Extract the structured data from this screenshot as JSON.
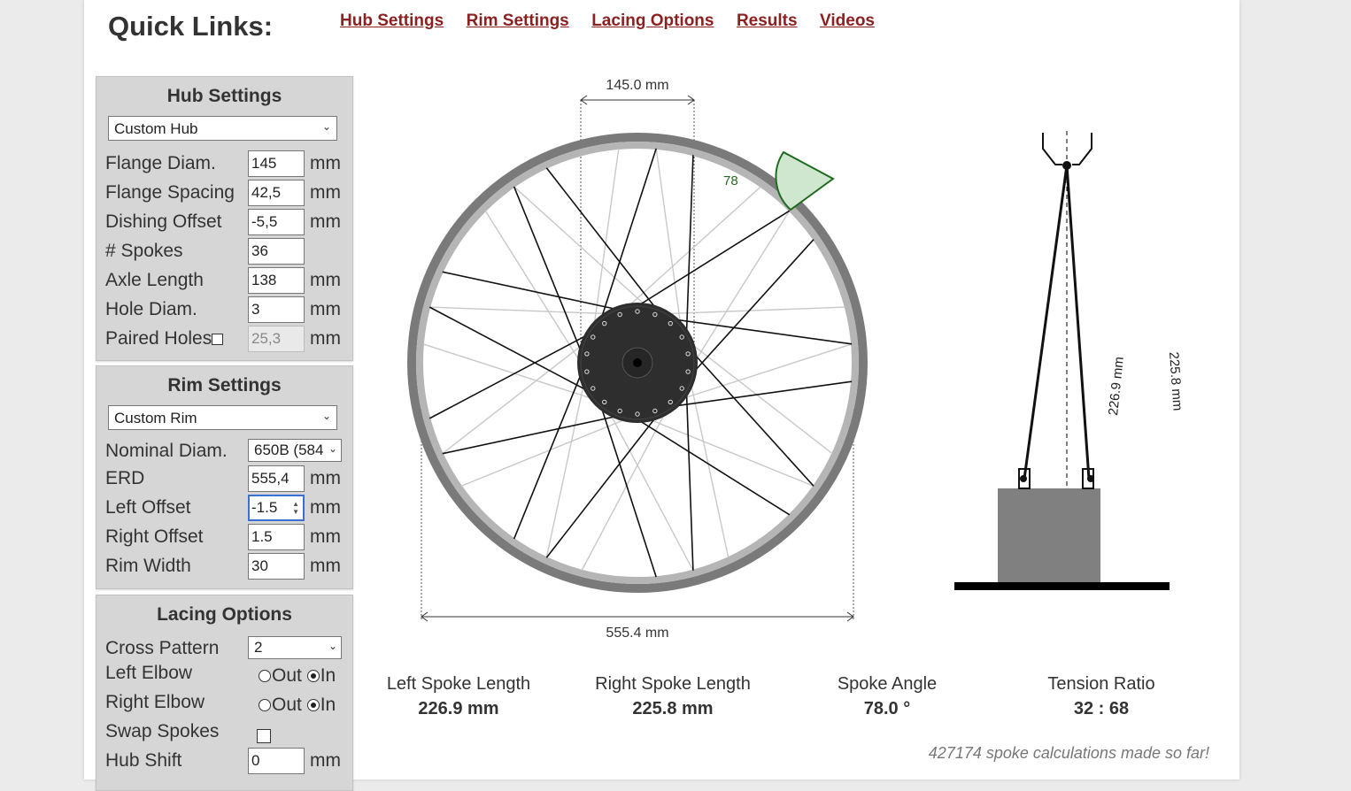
{
  "header": {
    "title": "Quick Links:",
    "links": [
      "Hub Settings",
      "Rim Settings",
      "Lacing Options",
      "Results",
      "Videos"
    ]
  },
  "hub": {
    "title": "Hub Settings",
    "preset": "Custom Hub",
    "fields": [
      {
        "label": "Flange Diam.",
        "value": "145",
        "unit": "mm"
      },
      {
        "label": "Flange Spacing",
        "value": "42,5",
        "unit": "mm"
      },
      {
        "label": "Dishing Offset",
        "value": "-5,5",
        "unit": "mm"
      },
      {
        "label": "# Spokes",
        "value": "36",
        "unit": ""
      },
      {
        "label": "Axle Length",
        "value": "138",
        "unit": "mm"
      },
      {
        "label": "Hole Diam.",
        "value": "3",
        "unit": "mm"
      }
    ],
    "paired": {
      "label": "Paired Holes",
      "value": "25,3",
      "unit": "mm"
    }
  },
  "rim": {
    "title": "Rim Settings",
    "preset": "Custom Rim",
    "nominal": {
      "label": "Nominal Diam.",
      "value": "650B (584"
    },
    "fields": [
      {
        "label": "ERD",
        "value": "555,4",
        "unit": "mm"
      },
      {
        "label": "Left Offset",
        "value": "-1.5",
        "unit": "mm"
      },
      {
        "label": "Right Offset",
        "value": "1.5",
        "unit": "mm"
      },
      {
        "label": "Rim Width",
        "value": "30",
        "unit": "mm"
      }
    ]
  },
  "lacing": {
    "title": "Lacing Options",
    "cross": {
      "label": "Cross Pattern",
      "value": "2"
    },
    "left_elbow": {
      "label": "Left Elbow",
      "out": "Out",
      "in": "In",
      "selected": "In"
    },
    "right_elbow": {
      "label": "Right Elbow",
      "out": "Out",
      "in": "In",
      "selected": "In"
    },
    "swap": {
      "label": "Swap Spokes"
    },
    "hub_shift": {
      "label": "Hub Shift",
      "value": "0",
      "unit": "mm"
    }
  },
  "diagram": {
    "flange_dim": "145.0 mm",
    "erd_dim": "555.4 mm",
    "angle_label": "78",
    "left_spoke_dim": "226.9 mm",
    "right_spoke_dim": "225.8 mm",
    "spoke_count": 36,
    "cross": 2
  },
  "results": [
    {
      "label": "Left Spoke Length",
      "value": "226.9 mm"
    },
    {
      "label": "Right Spoke Length",
      "value": "225.8 mm"
    },
    {
      "label": "Spoke Angle",
      "value": "78.0 °"
    },
    {
      "label": "Tension Ratio",
      "value": "32 : 68"
    }
  ],
  "footer": {
    "counter": "427174 spoke calculations made so far!"
  },
  "colors": {
    "link": "#8b2121",
    "panel": "#d6d6d6",
    "angle_fill": "#cfe6cf",
    "angle_stroke": "#1e6b1e",
    "hub": "#2e2e2e",
    "rim_outer": "#7a7a7a",
    "rim_inner": "#b5b5b5"
  }
}
